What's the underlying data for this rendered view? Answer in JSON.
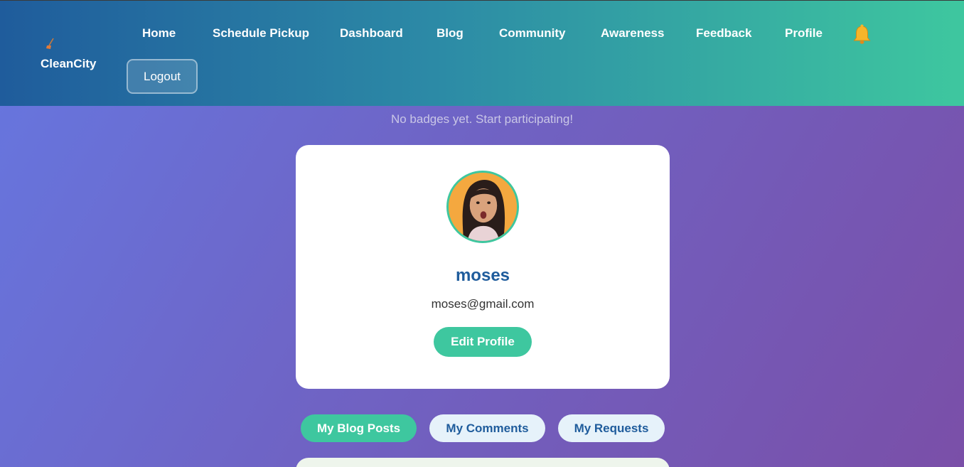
{
  "brand": {
    "name": "CleanCity",
    "icon": "broom-icon"
  },
  "nav": {
    "items": [
      "Home",
      "Schedule Pickup",
      "Dashboard",
      "Blog",
      "Community",
      "Awareness",
      "Feedback",
      "Profile"
    ],
    "notification_icon": "bell-icon",
    "logout_label": "Logout"
  },
  "badges": {
    "empty_message": "No badges yet. Start participating!"
  },
  "profile": {
    "username": "moses",
    "email": "moses@gmail.com",
    "edit_label": "Edit Profile"
  },
  "tabs": [
    {
      "label": "My Blog Posts",
      "active": true
    },
    {
      "label": "My Comments",
      "active": false
    },
    {
      "label": "My Requests",
      "active": false
    }
  ],
  "colors": {
    "accent": "#3ec79f",
    "primary": "#1f5c9c",
    "tab_inactive_bg": "#e6f2fa"
  }
}
